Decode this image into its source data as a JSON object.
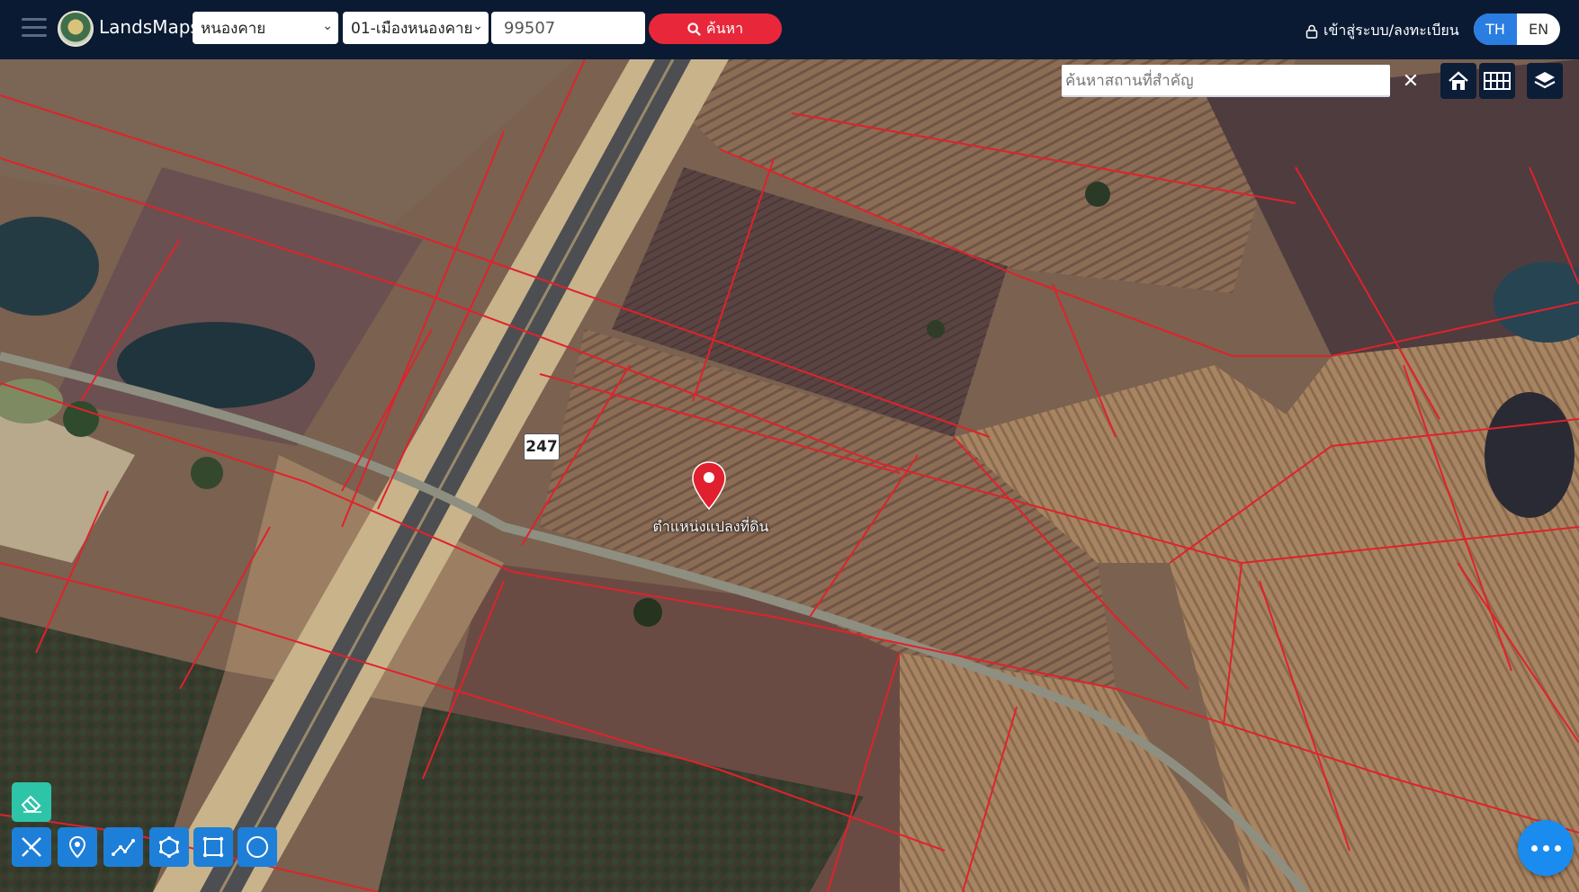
{
  "header": {
    "brand": "LandsMaps",
    "province": "หนองคาย",
    "district": "01-เมืองหนองคาย",
    "parcel_number": "99507",
    "search_label": "ค้นหา",
    "login_label": "เข้าสู่ระบบ/ลงทะเบียน",
    "lang_th": "TH",
    "lang_en": "EN",
    "active_lang": "TH"
  },
  "map": {
    "place_search_placeholder": "ค้นหาสถานที่สำคัญ",
    "marker_label": "ตำแหน่งแปลงที่ดิน",
    "route_number": "247",
    "parcel_line_color": "#e0222b",
    "tools": [
      "home-icon",
      "grid-icon",
      "layers-icon"
    ]
  },
  "drawing_tools": [
    "eraser-icon",
    "measure-icon",
    "marker-icon",
    "polyline-icon",
    "polygon-icon",
    "rectangle-icon",
    "circle-icon"
  ],
  "colors": {
    "header_bg": "#0a1a33",
    "search_button": "#e8283a",
    "lang_active": "#2a7de1",
    "fab": "#1a8cf0"
  }
}
